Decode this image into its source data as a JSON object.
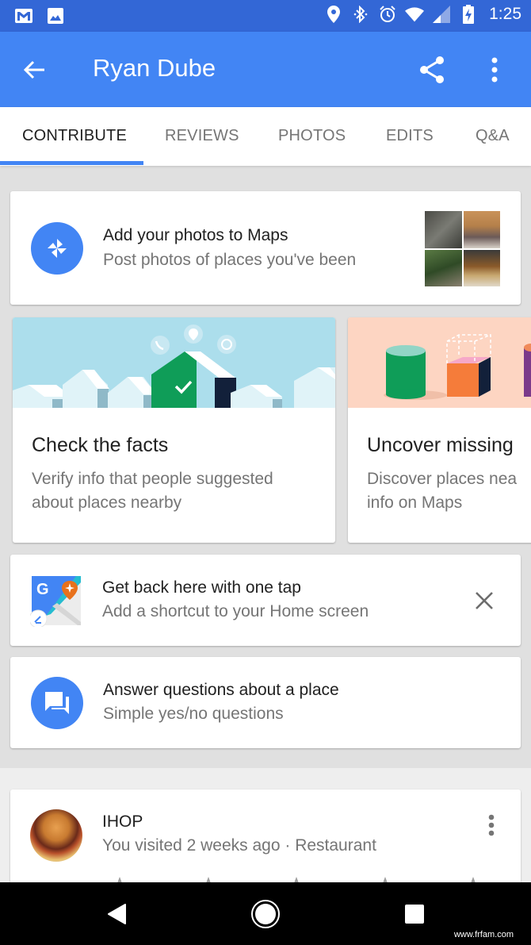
{
  "status_bar": {
    "left_icons": [
      "gmail-icon",
      "gallery-icon"
    ],
    "right_icons": [
      "location-icon",
      "bluetooth-icon",
      "alarm-icon",
      "wifi-icon",
      "signal-icon",
      "battery-charging-icon"
    ],
    "time": "1:25"
  },
  "app_bar": {
    "title": "Ryan Dube",
    "back_icon": "arrow-back-icon",
    "share_icon": "share-icon",
    "more_icon": "more-vert-icon",
    "color": "#4285f4"
  },
  "tabs": [
    {
      "label": "CONTRIBUTE",
      "active": true
    },
    {
      "label": "REVIEWS",
      "active": false
    },
    {
      "label": "PHOTOS",
      "active": false
    },
    {
      "label": "EDITS",
      "active": false
    },
    {
      "label": "Q&A",
      "active": false
    }
  ],
  "cards": {
    "add_photos": {
      "title": "Add your photos to Maps",
      "subtitle": "Post photos of places you've been",
      "icon": "pinwheel-photos-icon"
    },
    "promos": [
      {
        "title": "Check the facts",
        "description_lines": [
          "Verify info that people suggested",
          "about places nearby"
        ],
        "illustration": "houses-checkmark-illustration"
      },
      {
        "title": "Uncover missing",
        "description_lines": [
          "Discover places nea",
          "info on Maps"
        ],
        "illustration": "shapes-illustration"
      }
    ],
    "shortcut": {
      "title": "Get back here with one tap",
      "subtitle": "Add a shortcut to your Home screen",
      "icon": "google-maps-shortcut-icon",
      "dismiss_icon": "close-icon"
    },
    "questions": {
      "title": "Answer questions about a place",
      "subtitle": "Simple yes/no questions",
      "icon": "chat-bubbles-icon"
    },
    "place": {
      "name": "IHOP",
      "subtitle": "You visited 2 weeks ago · Restaurant",
      "rating_stars": 5,
      "more_icon": "more-vert-icon"
    }
  },
  "nav_bar": {
    "back": "nav-back-icon",
    "home": "nav-home-icon",
    "recents": "nav-recents-icon"
  },
  "watermark": "www.frfam.com"
}
